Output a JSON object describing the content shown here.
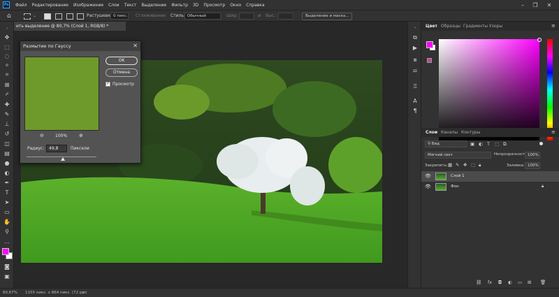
{
  "menu": [
    "Файл",
    "Редактирование",
    "Изображение",
    "Слои",
    "Текст",
    "Выделение",
    "Фильтр",
    "3D",
    "Просмотр",
    "Окно",
    "Справка"
  ],
  "app_logo": "Ps",
  "options": {
    "feather_label": "Растушевка:",
    "feather_value": "0 пикс.",
    "antialias_label": "Сглаживание",
    "style_label": "Стиль:",
    "style_value": "Обычный",
    "width_label": "Шир.:",
    "height_label": "Выс.:",
    "select_mask_btn": "Выделение и маска..."
  },
  "document_tab": "ить выделение @ 80,7% (Слой 1, RGB/8) *",
  "dialog": {
    "title": "Размытие по Гауссу",
    "ok": "OK",
    "cancel": "Отмена",
    "preview_label": "Просмотр",
    "preview_checked": true,
    "zoom": "100%",
    "radius_label": "Радиус:",
    "radius_value": "49,8",
    "radius_unit": "Пиксели",
    "radius_slider_fraction": 0.52
  },
  "panels": {
    "color_tabs": [
      "Цвет",
      "Образцы",
      "Градиенты",
      "Узоры"
    ],
    "foreground_color": "#ff00ff",
    "background_color": "#ffffff",
    "layers_tabs": [
      "Слои",
      "Каналы",
      "Контуры"
    ],
    "kind_filter": "Вид",
    "blend_mode": "Мягкий свет",
    "opacity_label": "Непрозрачность:",
    "opacity_value": "100%",
    "lock_label": "Закрепить:",
    "fill_label": "Заливка:",
    "fill_value": "100%",
    "layers": [
      {
        "name": "Слой 1",
        "selected": true,
        "locked": false
      },
      {
        "name": "Фон",
        "selected": false,
        "locked": true
      }
    ]
  },
  "status": {
    "zoom": "80,67%",
    "doc_info": "1155 пикс. x 864 пикс. (72 ppi)"
  }
}
